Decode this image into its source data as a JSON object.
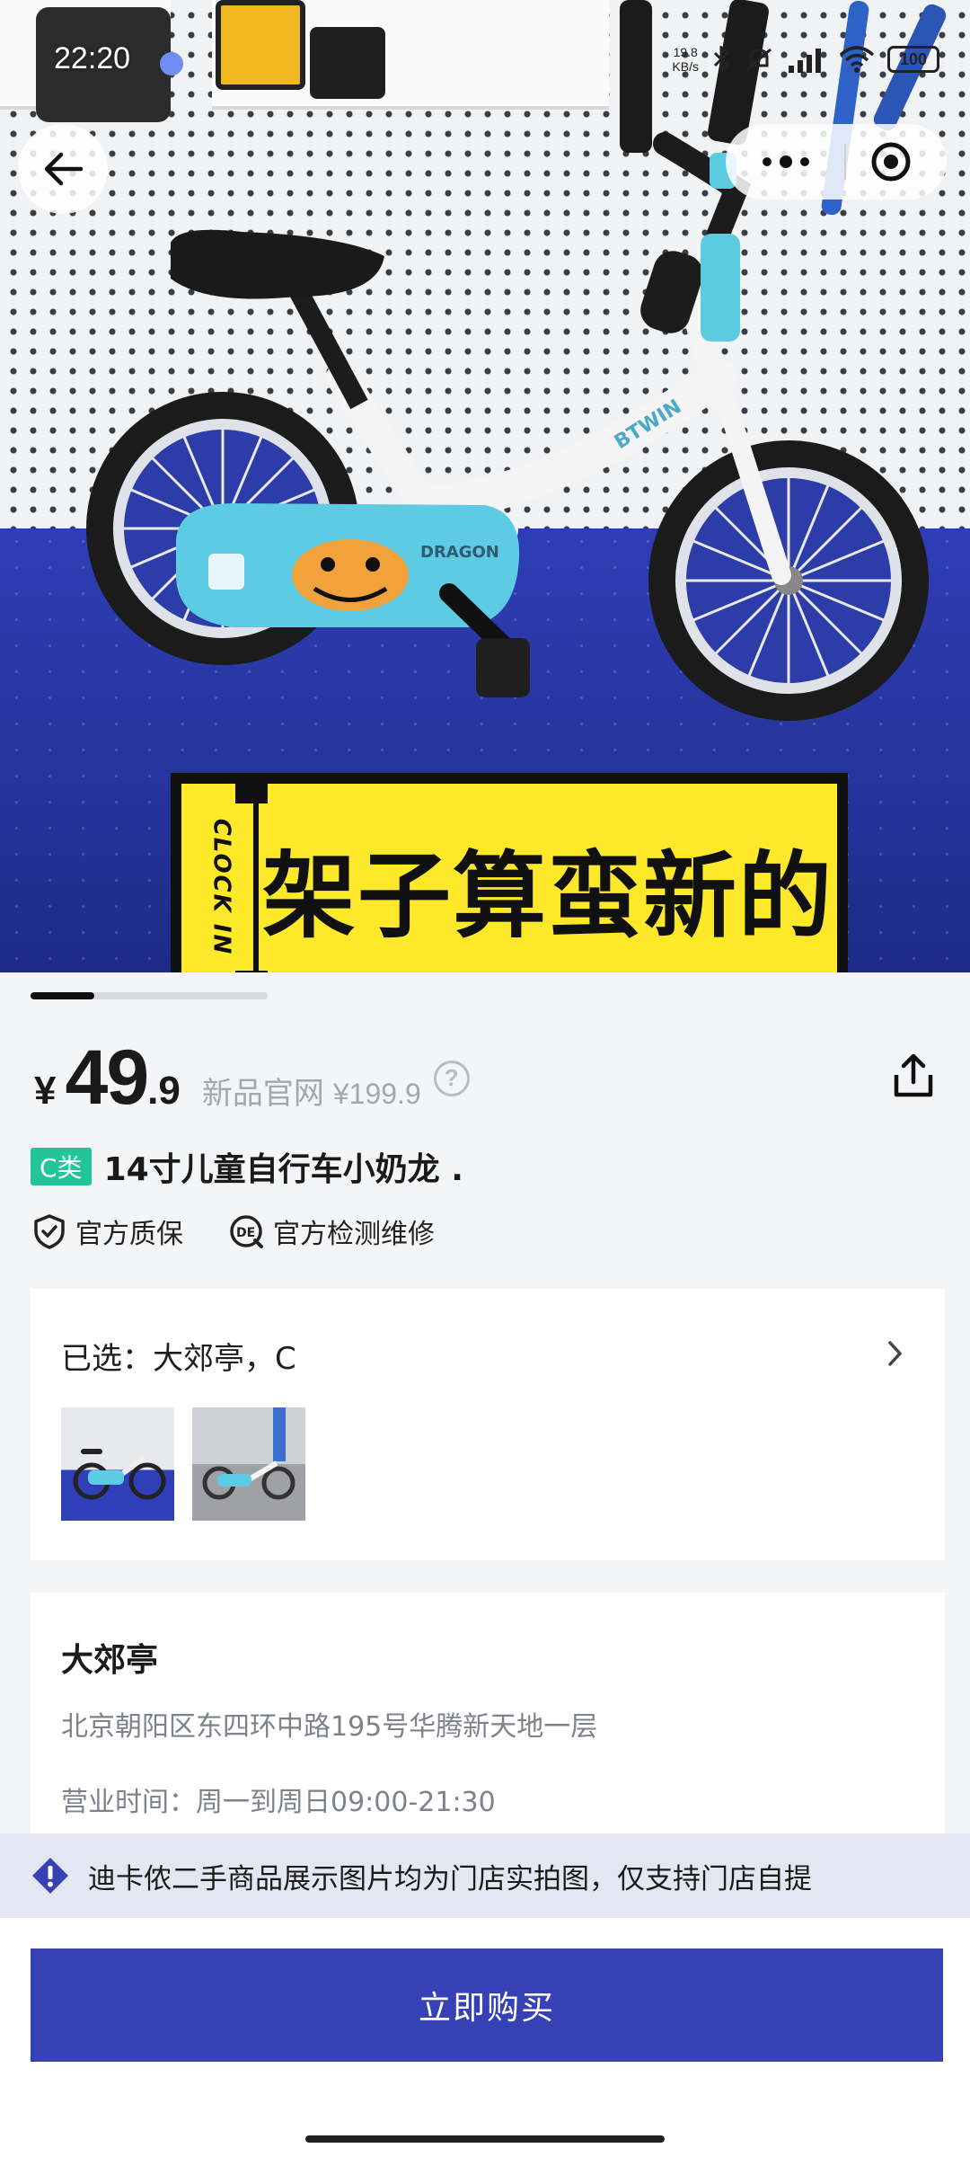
{
  "status_bar": {
    "time": "22:20",
    "net_speed_top": "19.8",
    "net_speed_bottom": "KB/s",
    "battery": "100"
  },
  "hero": {
    "sticker_side_text": "CLOCK IN",
    "sticker_main_text": "架子算蛮新的",
    "bike_decal_text": "DRAGON",
    "frame_brand_text": "BTWIN",
    "image_count_indicator": {
      "current": 1,
      "fraction_shown": 0.27
    }
  },
  "product": {
    "currency": "¥",
    "price_int": "49",
    "price_dec": ".9",
    "orig_label": "新品官网",
    "orig_price": "¥199.9",
    "help_symbol": "?",
    "grade": "C类",
    "title": "14寸儿童自行车小奶龙 .",
    "badges": [
      "官方质保",
      "官方检测维修"
    ]
  },
  "selection": {
    "label": "已选：大郊亭，C"
  },
  "store": {
    "name": "大郊亭",
    "address": "北京朝阳区东四环中路195号华腾新天地一层",
    "hours": "营业时间：周一到周日09:00-21:30"
  },
  "notice": {
    "text": "迪卡侬二手商品展示图片均为门店实拍图，仅支持门店自提"
  },
  "actions": {
    "buy_label": "立即购买"
  },
  "icons": {
    "back": "back-arrow-icon",
    "more": "more-dots-icon",
    "close_target": "target-icon",
    "share": "share-icon",
    "shield": "shield-check-icon",
    "inspect": "inspect-badge-icon",
    "chevron": "chevron-right-icon",
    "warning": "warning-diamond-icon"
  },
  "colors": {
    "accent": "#3641b6",
    "grade_badge": "#22c49a",
    "sticker_yellow": "#fde82a",
    "notice_bg": "#e4e6f2"
  }
}
